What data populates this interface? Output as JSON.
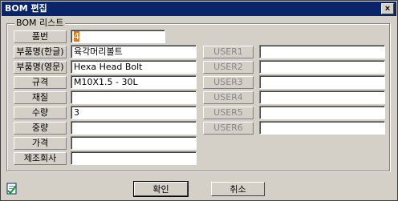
{
  "window": {
    "title": "BOM 편집",
    "close": "×"
  },
  "group": {
    "label": "BOM 리스트"
  },
  "left_fields": [
    {
      "label": "품번",
      "value": "4"
    },
    {
      "label": "부품명(한글)",
      "value": "육각머리볼트"
    },
    {
      "label": "부품명(영문)",
      "value": "Hexa Head Bolt"
    },
    {
      "label": "규격",
      "value": "M10X1.5 - 30L"
    },
    {
      "label": "재질",
      "value": ""
    },
    {
      "label": "수량",
      "value": "3"
    },
    {
      "label": "중량",
      "value": ""
    },
    {
      "label": "가격",
      "value": ""
    },
    {
      "label": "제조회사",
      "value": ""
    }
  ],
  "right_fields": [
    {
      "label": "USER1",
      "value": ""
    },
    {
      "label": "USER2",
      "value": ""
    },
    {
      "label": "USER3",
      "value": ""
    },
    {
      "label": "USER4",
      "value": ""
    },
    {
      "label": "USER5",
      "value": ""
    },
    {
      "label": "USER6",
      "value": ""
    }
  ],
  "buttons": {
    "ok": "확인",
    "cancel": "취소"
  },
  "colors": {
    "titlebar": "#0a246a",
    "face": "#d4d0c8",
    "caret": "#e07a10"
  }
}
